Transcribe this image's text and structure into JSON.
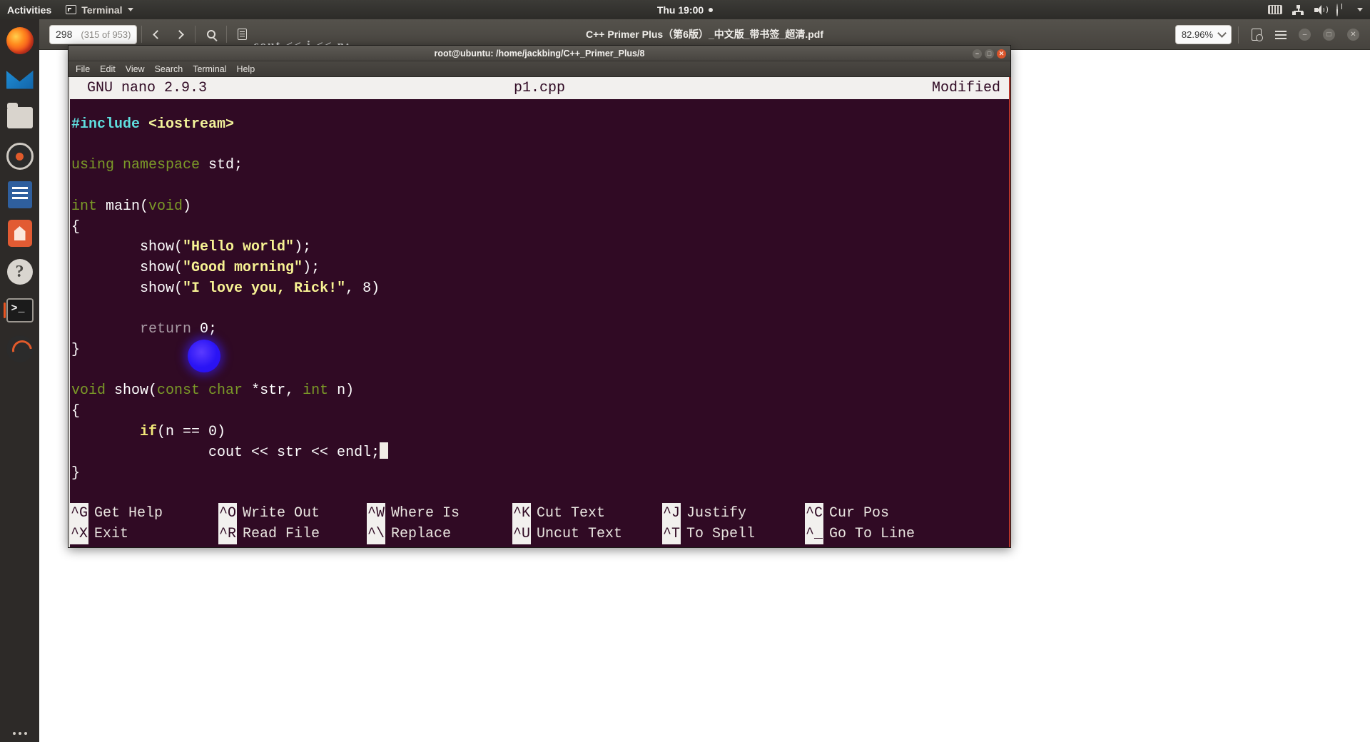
{
  "desktop": {
    "activities_label": "Activities",
    "app_menu_label": "Terminal",
    "clock": "Thu 19:00",
    "app_menu_icon": "terminal-icon",
    "indicator_icons": [
      "keyboard-icon",
      "network-icon",
      "volume-icon",
      "power-icon",
      "chevron-down-icon"
    ]
  },
  "dock": {
    "items": [
      {
        "name": "firefox",
        "label": "Firefox Web Browser"
      },
      {
        "name": "thunderbird",
        "label": "Thunderbird Mail"
      },
      {
        "name": "files",
        "label": "Files"
      },
      {
        "name": "rhythmbox",
        "label": "Rhythmbox"
      },
      {
        "name": "libreoffice",
        "label": "LibreOffice Writer"
      },
      {
        "name": "software",
        "label": "Ubuntu Software"
      },
      {
        "name": "help",
        "label": "Help"
      },
      {
        "name": "terminal",
        "label": "Terminal"
      },
      {
        "name": "amend",
        "label": "Ubuntu Swirl"
      }
    ],
    "show_apps_label": "Show Applications"
  },
  "pdf_viewer": {
    "title": "C++ Primer Plus（第6版）_中文版_带书签_超清.pdf",
    "page_current": "298",
    "page_total": "(315 of 953)",
    "zoom_value": "82.96%",
    "toolbar_icons": [
      "previous-page-icon",
      "next-page-icon",
      "search-icon",
      "sidebar-icon",
      "find-icon",
      "menu-icon"
    ],
    "window_buttons": [
      "minimize-button",
      "maximize-button",
      "close-button"
    ],
    "faint_page_text": "cout << i <<  n;"
  },
  "terminal": {
    "title": "root@ubuntu: /home/jackbing/C++_Primer_Plus/8",
    "menu": [
      "File",
      "Edit",
      "View",
      "Search",
      "Terminal",
      "Help"
    ],
    "window_buttons": [
      "minimize-button",
      "maximize-button",
      "close-button"
    ]
  },
  "nano": {
    "version_label": "GNU nano 2.9.3",
    "filename": "p1.cpp",
    "status": "Modified",
    "code_lines": [
      [
        {
          "t": "#include ",
          "c": "c-pre"
        },
        {
          "t": "<iostream>",
          "c": "c-hdr"
        }
      ],
      [
        {
          "t": "",
          "c": "c-w"
        }
      ],
      [
        {
          "t": "using namespace ",
          "c": "c-kw"
        },
        {
          "t": "std;",
          "c": "c-w"
        }
      ],
      [
        {
          "t": "",
          "c": "c-w"
        }
      ],
      [
        {
          "t": "int ",
          "c": "c-kw"
        },
        {
          "t": "main(",
          "c": "c-w"
        },
        {
          "t": "void",
          "c": "c-kw"
        },
        {
          "t": ")",
          "c": "c-w"
        }
      ],
      [
        {
          "t": "{",
          "c": "c-w"
        }
      ],
      [
        {
          "t": "        show(",
          "c": "c-w"
        },
        {
          "t": "\"Hello world\"",
          "c": "c-str"
        },
        {
          "t": ");",
          "c": "c-w"
        }
      ],
      [
        {
          "t": "        show(",
          "c": "c-w"
        },
        {
          "t": "\"Good morning\"",
          "c": "c-str"
        },
        {
          "t": ");",
          "c": "c-w"
        }
      ],
      [
        {
          "t": "        show(",
          "c": "c-w"
        },
        {
          "t": "\"I love you, Rick!\"",
          "c": "c-str"
        },
        {
          "t": ", 8)",
          "c": "c-w"
        }
      ],
      [
        {
          "t": "",
          "c": "c-w"
        }
      ],
      [
        {
          "t": "        ",
          "c": "c-w"
        },
        {
          "t": "return",
          "c": "c-dim"
        },
        {
          "t": " 0;",
          "c": "c-w"
        }
      ],
      [
        {
          "t": "}",
          "c": "c-w"
        }
      ],
      [
        {
          "t": "",
          "c": "c-w"
        }
      ],
      [
        {
          "t": "void ",
          "c": "c-kw"
        },
        {
          "t": "show(",
          "c": "c-w"
        },
        {
          "t": "const char ",
          "c": "c-kw"
        },
        {
          "t": "*str, ",
          "c": "c-w"
        },
        {
          "t": "int ",
          "c": "c-kw"
        },
        {
          "t": "n)",
          "c": "c-w"
        }
      ],
      [
        {
          "t": "{",
          "c": "c-w"
        }
      ],
      [
        {
          "t": "        ",
          "c": "c-w"
        },
        {
          "t": "if",
          "c": "c-ctl"
        },
        {
          "t": "(n == 0)",
          "c": "c-w"
        }
      ],
      [
        {
          "t": "                cout << str << endl;",
          "c": "c-w"
        },
        {
          "t": "█",
          "c": "c-cursor"
        }
      ],
      [
        {
          "t": "}",
          "c": "c-w"
        }
      ]
    ],
    "shortcuts_row1": [
      {
        "key": "^G",
        "label": "Get Help"
      },
      {
        "key": "^O",
        "label": "Write Out"
      },
      {
        "key": "^W",
        "label": "Where Is"
      },
      {
        "key": "^K",
        "label": "Cut Text"
      },
      {
        "key": "^J",
        "label": "Justify"
      },
      {
        "key": "^C",
        "label": "Cur Pos"
      }
    ],
    "shortcuts_row2": [
      {
        "key": "^X",
        "label": "Exit"
      },
      {
        "key": "^R",
        "label": "Read File"
      },
      {
        "key": "^\\",
        "label": "Replace"
      },
      {
        "key": "^U",
        "label": "Uncut Text"
      },
      {
        "key": "^T",
        "label": "To Spell"
      },
      {
        "key": "^_",
        "label": "Go To Line"
      }
    ]
  },
  "colors": {
    "terminal_bg": "#300a24",
    "ubuntu_orange": "#e95420",
    "string_yellow": "#f7f293",
    "keyword_green": "#7b9a28",
    "preproc_cyan": "#5fdede",
    "cursor_blob": "#2a14f5"
  }
}
